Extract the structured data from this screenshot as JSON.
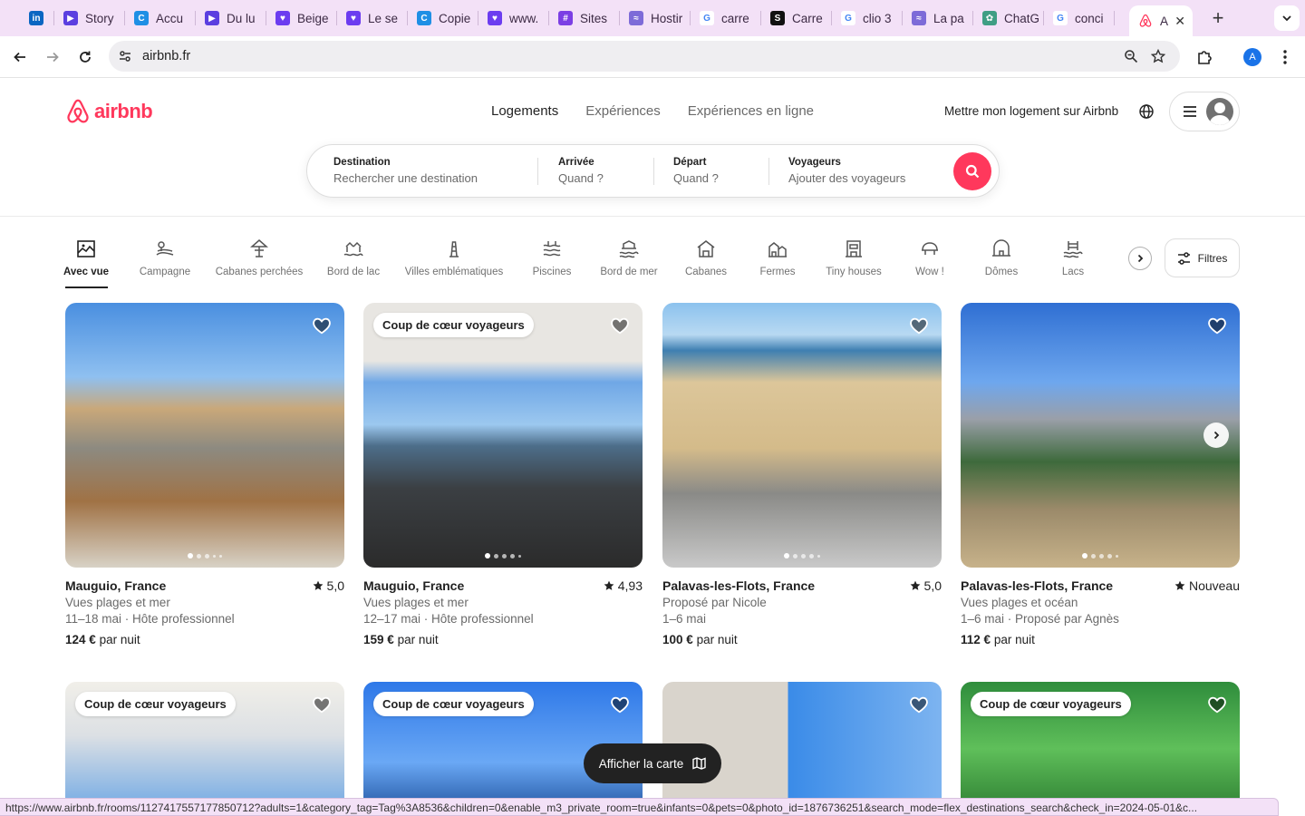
{
  "browser": {
    "tabs": [
      {
        "label": "",
        "icon": "linkedin-icon",
        "color": "#0a66c2"
      },
      {
        "label": "Story",
        "icon": "meet-icon",
        "color": "#5b3fe0"
      },
      {
        "label": "Accu",
        "icon": "canva-icon",
        "color": "#1f8fe5"
      },
      {
        "label": "Du lu",
        "icon": "meet-icon",
        "color": "#5b3fe0"
      },
      {
        "label": "Beige",
        "icon": "heart-chat-icon",
        "color": "#6c3cf0"
      },
      {
        "label": "Le se",
        "icon": "heart-chat-icon",
        "color": "#6c3cf0"
      },
      {
        "label": "Copie",
        "icon": "canva-icon",
        "color": "#1f8fe5"
      },
      {
        "label": "www.",
        "icon": "heart-chat-icon",
        "color": "#6c3cf0"
      },
      {
        "label": "Sites",
        "icon": "sites-icon",
        "color": "#7b3fe4"
      },
      {
        "label": "Hostir",
        "icon": "cloud-icon",
        "color": "#7d6bd8"
      },
      {
        "label": "carre",
        "icon": "google-icon",
        "color": "#4285f4"
      },
      {
        "label": "Carre",
        "icon": "s-icon",
        "color": "#111111"
      },
      {
        "label": "clio 3",
        "icon": "google-icon",
        "color": "#4285f4"
      },
      {
        "label": "La pa",
        "icon": "cloud-icon",
        "color": "#7d6bd8"
      },
      {
        "label": "ChatG",
        "icon": "chatgpt-icon",
        "color": "#3f9e84"
      },
      {
        "label": "conci",
        "icon": "google-icon",
        "color": "#4285f4"
      }
    ],
    "active_tab": {
      "label": "A",
      "icon": "airbnb-icon"
    },
    "new_tab": "+",
    "url": "airbnb.fr",
    "profile_letter": "A",
    "status_url": "https://www.airbnb.fr/rooms/1127417557177850712?adults=1&category_tag=Tag%3A8536&children=0&enable_m3_private_room=true&infants=0&pets=0&photo_id=1876736251&search_mode=flex_destinations_search&check_in=2024-05-01&c..."
  },
  "header": {
    "brand": "airbnb",
    "brand_color": "#ff385c",
    "nav": [
      "Logements",
      "Expériences",
      "Expériences en ligne"
    ],
    "host_link": "Mettre mon logement sur Airbnb"
  },
  "search": {
    "destination": {
      "title": "Destination",
      "placeholder": "Rechercher une destination"
    },
    "checkin": {
      "title": "Arrivée",
      "placeholder": "Quand ?"
    },
    "checkout": {
      "title": "Départ",
      "placeholder": "Quand ?"
    },
    "guests": {
      "title": "Voyageurs",
      "placeholder": "Ajouter des voyageurs"
    }
  },
  "categories": [
    {
      "label": "Avec vue",
      "icon": "view-icon"
    },
    {
      "label": "Campagne",
      "icon": "countryside-icon"
    },
    {
      "label": "Cabanes perchées",
      "icon": "treehouse-icon"
    },
    {
      "label": "Bord de lac",
      "icon": "lakefront-icon"
    },
    {
      "label": "Villes emblématiques",
      "icon": "iconic-city-icon"
    },
    {
      "label": "Piscines",
      "icon": "pool-icon"
    },
    {
      "label": "Bord de mer",
      "icon": "beachfront-icon"
    },
    {
      "label": "Cabanes",
      "icon": "cabin-icon"
    },
    {
      "label": "Fermes",
      "icon": "farm-icon"
    },
    {
      "label": "Tiny houses",
      "icon": "tiny-house-icon"
    },
    {
      "label": "Wow !",
      "icon": "wow-icon"
    },
    {
      "label": "Dômes",
      "icon": "dome-icon"
    },
    {
      "label": "Lacs",
      "icon": "lake-icon"
    }
  ],
  "filters_label": "Filtres",
  "listings": [
    {
      "badge": "",
      "location": "Mauguio, France",
      "rating": "5,0",
      "line1": "Vues plages et mer",
      "line2": "11–18 mai · Hôte professionnel",
      "price": "124 €",
      "per": "par nuit"
    },
    {
      "badge": "Coup de cœur voyageurs",
      "location": "Mauguio, France",
      "rating": "4,93",
      "line1": "Vues plages et mer",
      "line2": "12–17 mai · Hôte professionnel",
      "price": "159 €",
      "per": "par nuit"
    },
    {
      "badge": "",
      "location": "Palavas-les-Flots, France",
      "rating": "5,0",
      "line1": "Proposé par Nicole",
      "line2": "1–6 mai",
      "price": "100 €",
      "per": "par nuit"
    },
    {
      "badge": "",
      "location": "Palavas-les-Flots, France",
      "rating": "Nouveau",
      "line1": "Vues plages et océan",
      "line2": "1–6 mai · Proposé par Agnès",
      "price": "112 €",
      "per": "par nuit"
    },
    {
      "badge": "Coup de cœur voyageurs"
    },
    {
      "badge": "Coup de cœur voyageurs"
    },
    {
      "badge": ""
    },
    {
      "badge": "Coup de cœur voyageurs"
    }
  ],
  "map_button": "Afficher la carte"
}
